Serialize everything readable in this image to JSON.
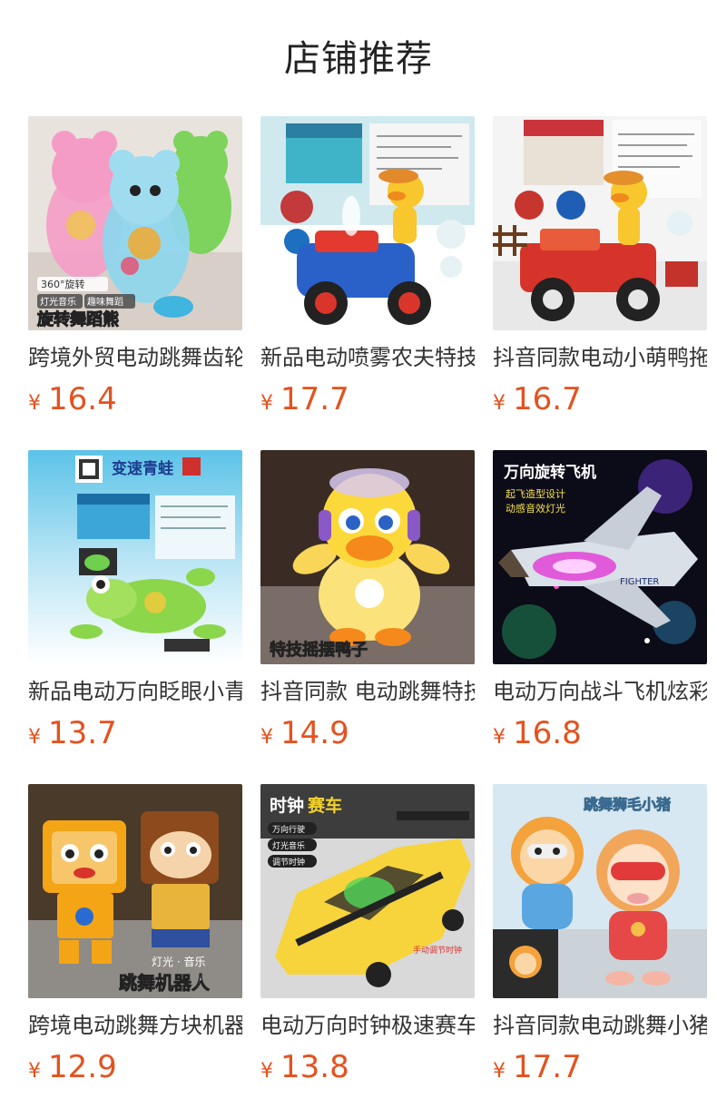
{
  "page": {
    "title": "店铺推荐",
    "accent_color": "#e4521f"
  },
  "products": [
    {
      "name": "跨境外贸电动跳舞齿轮熊",
      "currency": "¥",
      "price": "16.4",
      "image_icon": "dancing-gear-bear-image",
      "image_text": {
        "badge1": "360°旋转",
        "badge2": "灯光音乐",
        "badge3": "趣味舞蹈",
        "caption": "旋转舞蹈熊"
      }
    },
    {
      "name": "新品电动喷雾农夫特技车",
      "currency": "¥",
      "price": "17.7",
      "image_icon": "spray-farmer-duck-car-image",
      "image_text": {}
    },
    {
      "name": "抖音同款电动小萌鸭拖拉机",
      "currency": "¥",
      "price": "16.7",
      "image_icon": "duck-tractor-image",
      "image_text": {}
    },
    {
      "name": "新品电动万向眨眼小青蛙",
      "currency": "¥",
      "price": "13.7",
      "image_icon": "speed-frog-image",
      "image_text": {
        "caption": "变速青蛙"
      }
    },
    {
      "name": "抖音同款 电动跳舞特技鸭子",
      "currency": "¥",
      "price": "14.9",
      "image_icon": "swing-duck-image",
      "image_text": {
        "caption": "特技摇摆鸭子"
      }
    },
    {
      "name": "电动万向战斗飞机炫彩灯光",
      "currency": "¥",
      "price": "16.8",
      "image_icon": "fighter-plane-image",
      "image_text": {
        "caption": "万向旋转飞机",
        "line1": "起飞造型设计",
        "line2": "动感音效灯光"
      }
    },
    {
      "name": "跨境电动跳舞方块机器人",
      "currency": "¥",
      "price": "12.9",
      "image_icon": "cube-robot-image",
      "image_text": {
        "line1": "灯光 · 音乐",
        "caption": "跳舞机器人"
      }
    },
    {
      "name": "电动万向时钟极速赛车",
      "currency": "¥",
      "price": "13.8",
      "image_icon": "clock-race-car-image",
      "image_text": {
        "caption_a": "时钟",
        "caption_b": "赛车",
        "badge1": "万向行驶",
        "badge2": "灯光音乐",
        "badge3": "调节时钟",
        "note": "手动调节时钟"
      }
    },
    {
      "name": "抖音同款电动跳舞小猪狮",
      "currency": "¥",
      "price": "17.7",
      "image_icon": "dancing-lion-pig-image",
      "image_text": {
        "caption": "跳舞狮毛小猪"
      }
    }
  ]
}
